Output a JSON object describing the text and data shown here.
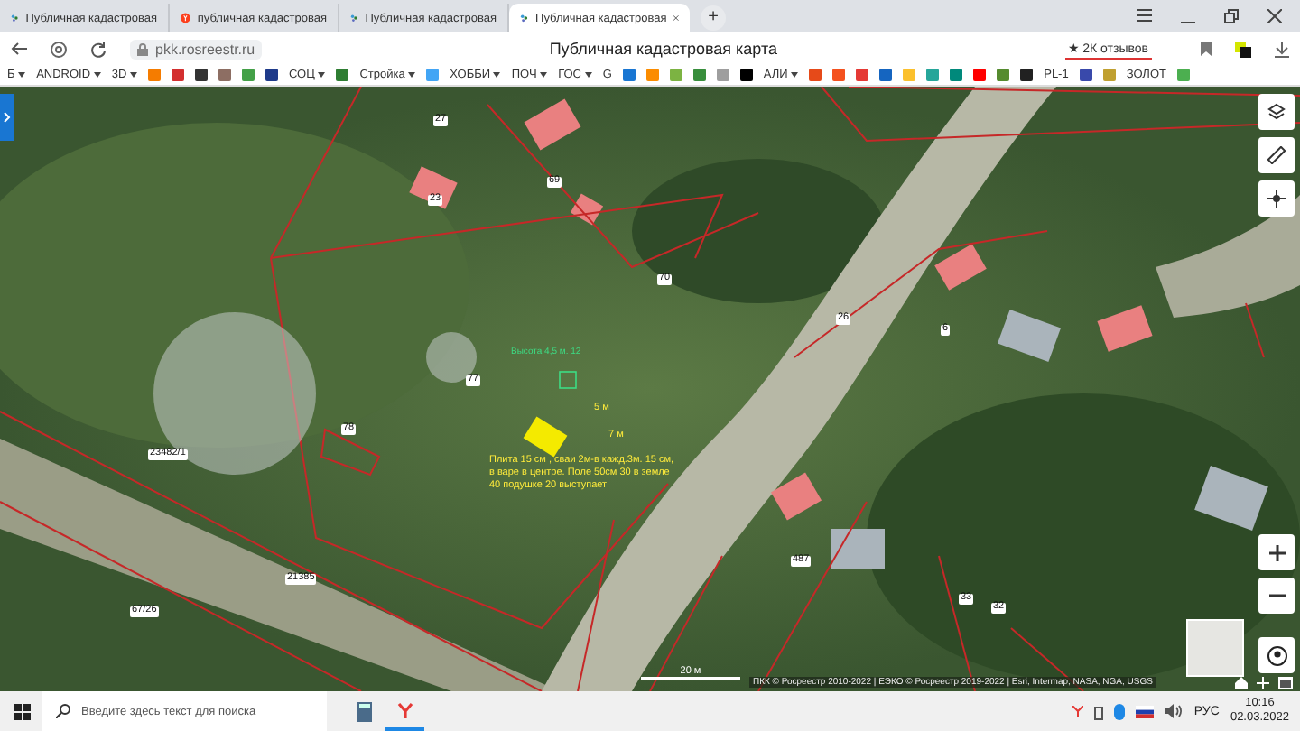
{
  "browser": {
    "tabs": [
      {
        "title": "Публичная кадастровая",
        "selected": false
      },
      {
        "title": "публичная кадастровая",
        "selected": false
      },
      {
        "title": "Публичная кадастровая",
        "selected": false
      },
      {
        "title": "Публичная кадастровая",
        "selected": true
      }
    ],
    "new_tab": "+",
    "address": "pkk.rosreestr.ru",
    "page_title": "Публичная кадастровая карта",
    "reviews": "★ 2К отзывов"
  },
  "bookmarks": [
    {
      "kind": "folder",
      "label": "Б"
    },
    {
      "kind": "folder",
      "label": "ANDROID"
    },
    {
      "kind": "folder",
      "label": "3D"
    },
    {
      "kind": "icon",
      "color": "#f57c00"
    },
    {
      "kind": "icon",
      "color": "#d32f2f"
    },
    {
      "kind": "icon",
      "color": "#333333"
    },
    {
      "kind": "icon",
      "color": "#8d6e63"
    },
    {
      "kind": "icon",
      "color": "#43a047"
    },
    {
      "kind": "icon",
      "color": "#1e3a8a"
    },
    {
      "kind": "folder",
      "label": "СОЦ"
    },
    {
      "kind": "icon",
      "color": "#2e7d32"
    },
    {
      "kind": "folder",
      "label": "Стройка"
    },
    {
      "kind": "icon",
      "color": "#42a5f5"
    },
    {
      "kind": "folder",
      "label": "ХОББИ"
    },
    {
      "kind": "folder",
      "label": "ПОЧ"
    },
    {
      "kind": "folder",
      "label": "ГОС"
    },
    {
      "kind": "link",
      "label": "G"
    },
    {
      "kind": "icon",
      "color": "#1976d2"
    },
    {
      "kind": "icon",
      "color": "#fb8c00"
    },
    {
      "kind": "icon",
      "color": "#7cb342"
    },
    {
      "kind": "icon",
      "color": "#388e3c"
    },
    {
      "kind": "icon",
      "color": "#9e9e9e"
    },
    {
      "kind": "icon",
      "color": "#000000"
    },
    {
      "kind": "folder",
      "label": "АЛИ"
    },
    {
      "kind": "icon",
      "color": "#e64a19"
    },
    {
      "kind": "icon",
      "color": "#f4511e"
    },
    {
      "kind": "icon",
      "color": "#e53935"
    },
    {
      "kind": "icon",
      "color": "#1565c0"
    },
    {
      "kind": "icon",
      "color": "#fbc02d"
    },
    {
      "kind": "icon",
      "color": "#26a69a"
    },
    {
      "kind": "icon",
      "color": "#00897b"
    },
    {
      "kind": "icon",
      "color": "#ff0000"
    },
    {
      "kind": "icon",
      "color": "#558b2f"
    },
    {
      "kind": "icon",
      "color": "#212121"
    },
    {
      "kind": "link",
      "label": "PL-1"
    },
    {
      "kind": "icon",
      "color": "#3949ab"
    },
    {
      "kind": "icon",
      "color": "#c0a030"
    },
    {
      "kind": "link",
      "label": "ЗОЛОТ"
    },
    {
      "kind": "icon",
      "color": "#4caf50"
    }
  ],
  "map": {
    "labels": [
      {
        "kind": "plot",
        "text": "27"
      },
      {
        "kind": "plot",
        "text": "23"
      },
      {
        "kind": "plot",
        "text": "69"
      },
      {
        "kind": "plot",
        "text": "70"
      },
      {
        "kind": "plot",
        "text": "77"
      },
      {
        "kind": "plot",
        "text": "78"
      },
      {
        "kind": "plot",
        "text": "26"
      },
      {
        "kind": "plot",
        "text": "6"
      },
      {
        "kind": "plot",
        "text": "23482/1"
      },
      {
        "kind": "plot",
        "text": "21385"
      },
      {
        "kind": "plot",
        "text": "67/26"
      },
      {
        "kind": "plot",
        "text": "487"
      },
      {
        "kind": "plot",
        "text": "33"
      },
      {
        "kind": "plot",
        "text": "32"
      },
      {
        "kind": "height",
        "text": "Высота 4,5 м. 12"
      },
      {
        "kind": "size",
        "text": "5 м"
      },
      {
        "kind": "size",
        "text": "7 м"
      },
      {
        "kind": "note",
        "text": "Плита 15 см , сваи 2м-в кажд.3м. 15 см, в варе в центре. Поле 50см 30 в земле 40 подушке 20 выступает"
      }
    ],
    "scale": "20 м",
    "attribution": "ПКК © Росреестр 2010-2022 | ЕЭКО © Росреестр 2019-2022 | Esri, Intermap, NASA, NGA, USGS"
  },
  "taskbar": {
    "search_placeholder": "Введите здесь текст для поиска",
    "language": "РУС",
    "time": "10:16",
    "date": "02.03.2022"
  }
}
